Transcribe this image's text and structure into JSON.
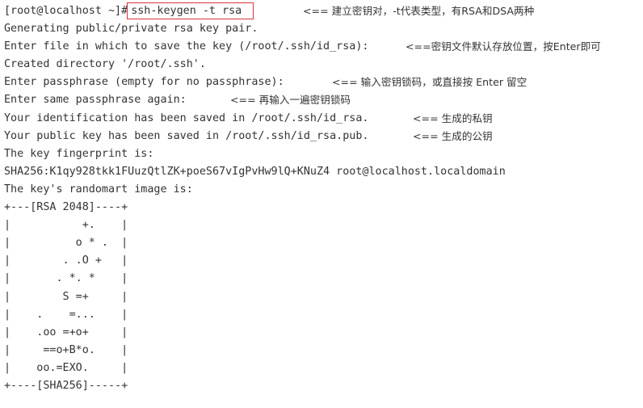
{
  "terminal": {
    "prompt": "[root@localhost ~]#",
    "command": "ssh-keygen -t rsa",
    "lines": [
      "Generating public/private rsa key pair.",
      "Enter file in which to save the key (/root/.ssh/id_rsa):",
      "Created directory '/root/.ssh'.",
      "Enter passphrase (empty for no passphrase):",
      "Enter same passphrase again:",
      "Your identification has been saved in /root/.ssh/id_rsa.",
      "Your public key has been saved in /root/.ssh/id_rsa.pub.",
      "The key fingerprint is:",
      "SHA256:K1qy928tkk1FUuzQtlZK+poeS67vIgPvHw9lQ+KNuZ4 root@localhost.localdomain",
      "The key's randomart image is:",
      "+---[RSA 2048]----+",
      "|           +.    |",
      "|          o * .  |",
      "|        . .O +   |",
      "|       . *. *    |",
      "|        S =+     |",
      "|    .    =...    |",
      "|    .oo =+o+     |",
      "|     ==o+B*o.    |",
      "|    oo.=EXO.     |",
      "+----[SHA256]-----+"
    ]
  },
  "annotations": {
    "command_note": "<== 建立密钥对，-t代表类型，有RSA和DSA两种",
    "save_location_note": "<==密钥文件默认存放位置，按Enter即可",
    "passphrase_note": "<== 输入密钥锁码，或直接按 Enter 留空",
    "repeat_passphrase_note": "<== 再输入一遍密钥锁码",
    "private_key_note": "<== 生成的私钥",
    "public_key_note": "<== 生成的公钥"
  },
  "colors": {
    "highlight_border": "#d9343b",
    "text": "#333333",
    "background": "#ffffff"
  }
}
